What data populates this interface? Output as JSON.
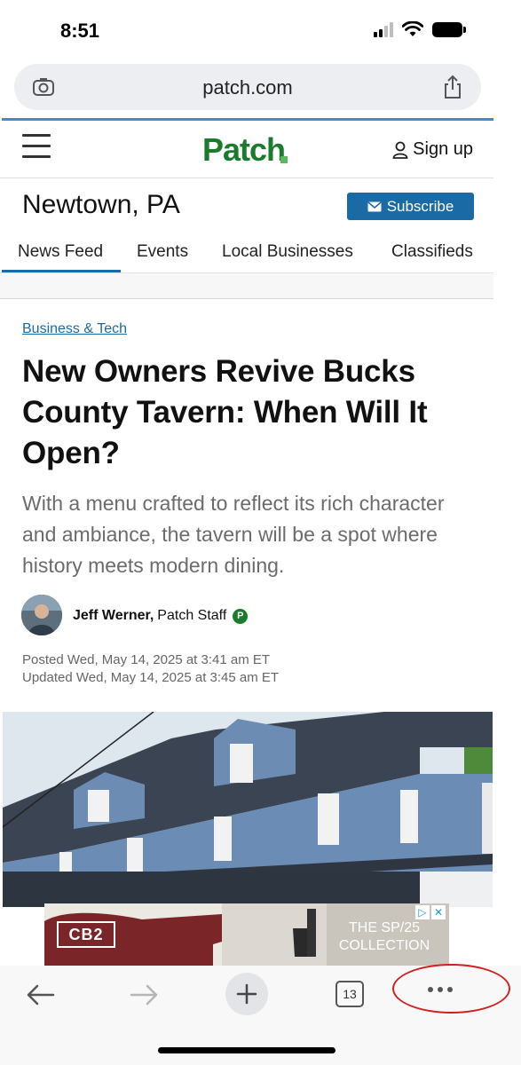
{
  "status_bar": {
    "time": "8:51",
    "signal_bars": 4,
    "signal_bars_active": 2
  },
  "browser": {
    "url": "patch.com",
    "camera_icon": "camera-search-icon",
    "share_icon": "share-icon"
  },
  "site": {
    "menu_icon": "hamburger-menu-icon",
    "logo": "Patch",
    "sign_up": "Sign up",
    "location": "Newtown, PA",
    "subscribe": "Subscribe",
    "brand_color": "#1b7b2d",
    "accent_color": "#1a6aa5"
  },
  "nav": {
    "items": [
      "News Feed",
      "Events",
      "Local Businesses",
      "Classifieds"
    ],
    "active": "News Feed"
  },
  "article": {
    "category": "Business & Tech",
    "headline": "New Owners Revive Bucks County Tavern: When Will It Open?",
    "dek": "With a menu crafted to reflect its rich character and ambiance, the tavern will be a spot where history meets modern dining.",
    "author": "Jeff Werner,",
    "author_role": "Patch Staff",
    "badge": "P",
    "posted": "Posted Wed, May 14, 2025 at 3:41 am ET",
    "updated": "Updated Wed, May 14, 2025 at 3:45 am ET"
  },
  "ad": {
    "brand": "CB2",
    "text": "THE SP/25 COLLECTION",
    "choices_play": "▷",
    "choices_close": "✕"
  },
  "toolbar": {
    "back_icon": "back-arrow-icon",
    "forward_icon": "forward-arrow-icon",
    "new_tab_icon": "plus-icon",
    "tab_count": "13",
    "more_icon": "more-dots-icon",
    "highlight_color": "#d21f1f"
  }
}
